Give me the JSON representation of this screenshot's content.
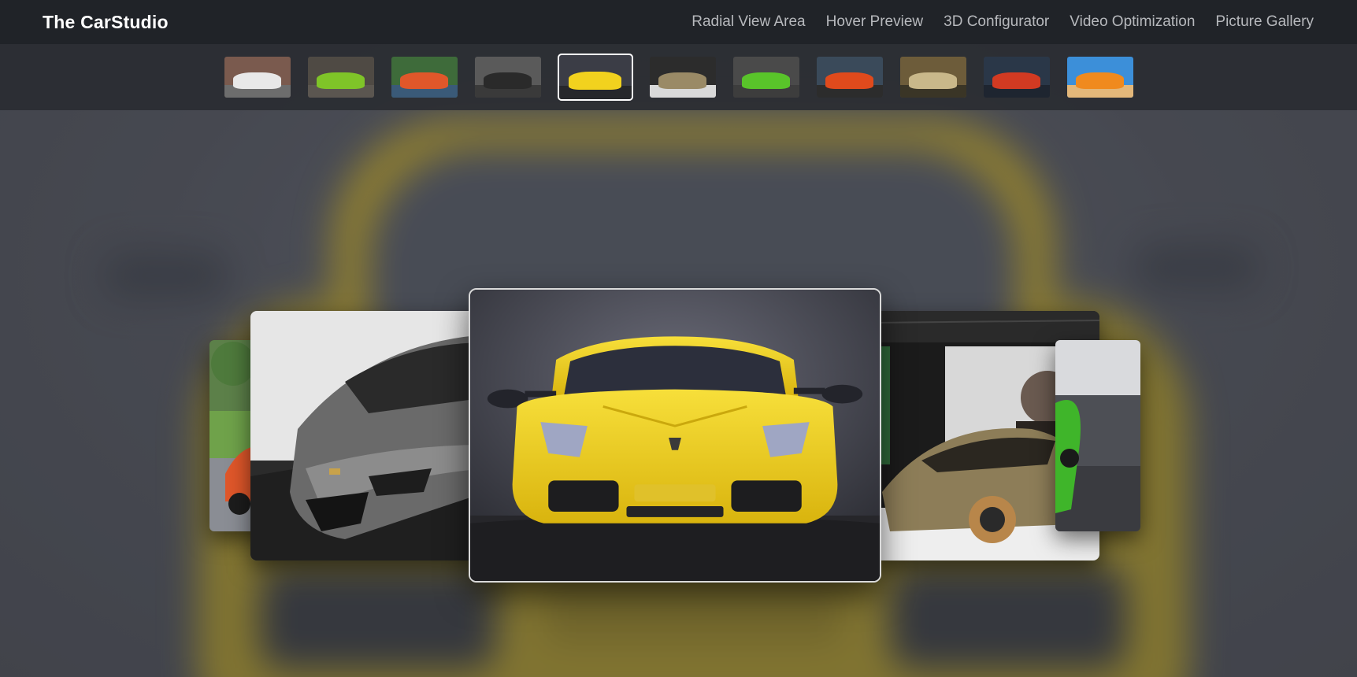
{
  "brand": {
    "name": "The CarStudio"
  },
  "nav": {
    "links": [
      {
        "label": "Radial View Area"
      },
      {
        "label": "Hover Preview"
      },
      {
        "label": "3D Configurator"
      },
      {
        "label": "Video Optimization"
      },
      {
        "label": "Picture Gallery"
      }
    ]
  },
  "thumbnails": {
    "active_index": 4,
    "items": [
      {
        "icon": "white-lamborghini-thumbnail",
        "sky": "#7a5a4e",
        "car": "#e8e8e8",
        "ground": "#6d6d6d"
      },
      {
        "icon": "green-lamborghini-thumbnail",
        "sky": "#4f4a44",
        "car": "#7fc428",
        "ground": "#5b5650"
      },
      {
        "icon": "orange-lamborghini-thumbnail",
        "sky": "#3e6b3a",
        "car": "#e0572a",
        "ground": "#3a5a78"
      },
      {
        "icon": "black-lamborghini-thumbnail",
        "sky": "#5a5a5a",
        "car": "#2a2a2a",
        "ground": "#3a3a3a"
      },
      {
        "icon": "yellow-lamborghini-thumbnail",
        "sky": "#3b3d46",
        "car": "#f2d21e",
        "ground": "#26272b"
      },
      {
        "icon": "gold-lamborghini-thumbnail",
        "sky": "#2c2c2c",
        "car": "#9a8a66",
        "ground": "#d9d9d9"
      },
      {
        "icon": "lime-lamborghini-thumbnail",
        "sky": "#4a4a4a",
        "car": "#59c42a",
        "ground": "#3d3d3d"
      },
      {
        "icon": "red-lamborghini-thumbnail",
        "sky": "#3a4a5a",
        "car": "#e04a1c",
        "ground": "#2c2c2c"
      },
      {
        "icon": "chrome-lamborghini-thumbnail",
        "sky": "#6d5c3a",
        "car": "#c9b88a",
        "ground": "#3a3526"
      },
      {
        "icon": "city-red-lamborghini-thumbnail",
        "sky": "#2a3748",
        "car": "#d23a22",
        "ground": "#1e2530"
      },
      {
        "icon": "desert-orange-lamborghini-thumbnail",
        "sky": "#3c8fd9",
        "car": "#f08a1e",
        "ground": "#e3b77a"
      }
    ]
  },
  "carousel": {
    "cards": [
      {
        "position": "far-left",
        "icon": "orange-car-photo"
      },
      {
        "position": "near-left",
        "icon": "gray-huracan-photo"
      },
      {
        "position": "center",
        "icon": "yellow-gallardo-photo"
      },
      {
        "position": "near-right",
        "icon": "gold-sian-photo"
      },
      {
        "position": "far-right",
        "icon": "green-car-photo"
      }
    ]
  },
  "colors": {
    "navbar_bg": "#202328",
    "nav_link": "#b7b9bd",
    "brand_text": "#ffffff",
    "accent_yellow": "#f2d21e"
  }
}
